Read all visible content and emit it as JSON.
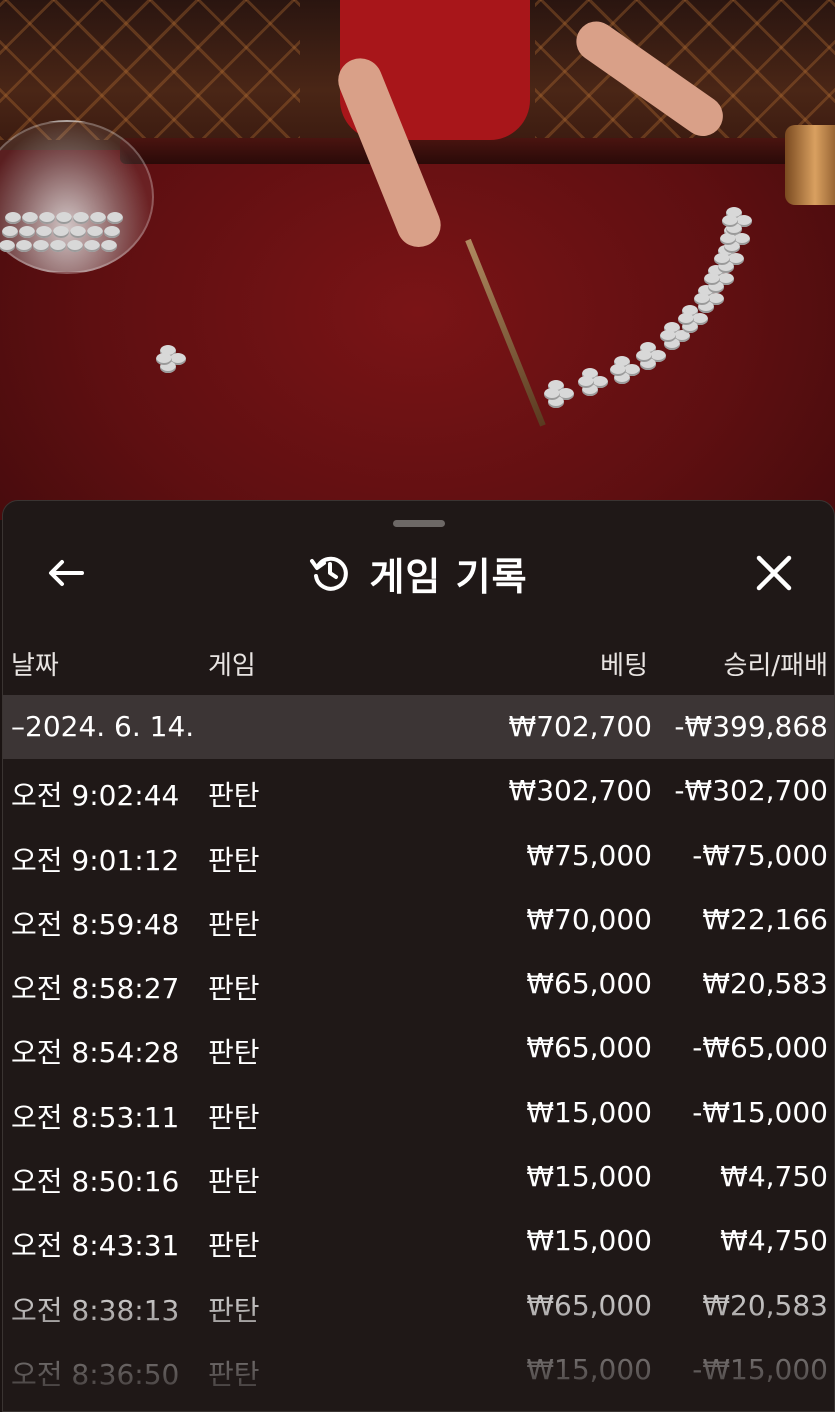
{
  "panel": {
    "title": "게임 기록",
    "icons": {
      "back": "arrow-left-icon",
      "history": "history-icon",
      "close": "close-icon"
    }
  },
  "columns": {
    "date": "날짜",
    "game": "게임",
    "bet": "베팅",
    "result": "승리/패배"
  },
  "summary": {
    "date": "–2024. 6. 14.",
    "bet": "₩702,700",
    "result": "-₩399,868"
  },
  "rows": [
    {
      "time": "오전 9:02:44",
      "game": "판탄",
      "bet": "₩302,700",
      "result": "-₩302,700"
    },
    {
      "time": "오전 9:01:12",
      "game": "판탄",
      "bet": "₩75,000",
      "result": "-₩75,000"
    },
    {
      "time": "오전 8:59:48",
      "game": "판탄",
      "bet": "₩70,000",
      "result": "₩22,166"
    },
    {
      "time": "오전 8:58:27",
      "game": "판탄",
      "bet": "₩65,000",
      "result": "₩20,583"
    },
    {
      "time": "오전 8:54:28",
      "game": "판탄",
      "bet": "₩65,000",
      "result": "-₩65,000"
    },
    {
      "time": "오전 8:53:11",
      "game": "판탄",
      "bet": "₩15,000",
      "result": "-₩15,000"
    },
    {
      "time": "오전 8:50:16",
      "game": "판탄",
      "bet": "₩15,000",
      "result": "₩4,750"
    },
    {
      "time": "오전 8:43:31",
      "game": "판탄",
      "bet": "₩15,000",
      "result": "₩4,750"
    },
    {
      "time": "오전 8:38:13",
      "game": "판탄",
      "bet": "₩65,000",
      "result": "₩20,583"
    },
    {
      "time": "오전 8:36:50",
      "game": "판탄",
      "bet": "₩15,000",
      "result": "-₩15,000"
    }
  ],
  "colors": {
    "sheet_bg": "#1f1817",
    "summary_bg": "#3c3535",
    "felt": "#7a1416"
  }
}
